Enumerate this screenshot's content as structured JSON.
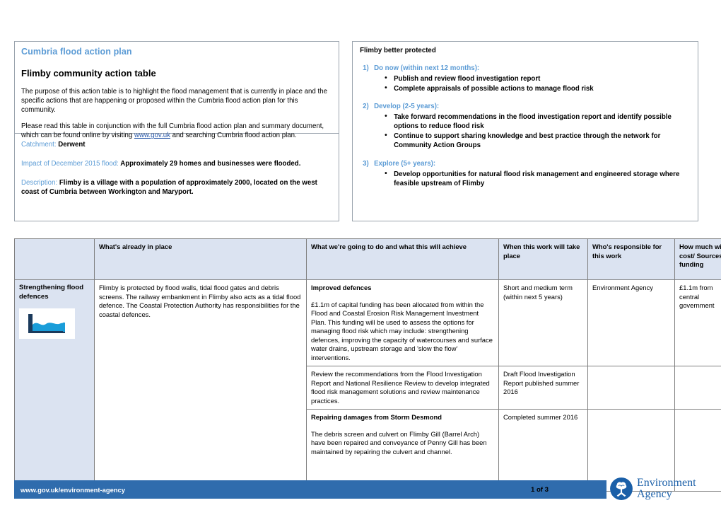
{
  "header": {
    "plan_title": "Cumbria flood action plan",
    "doc_title": "Flimby community action table",
    "purpose_paragraph": "The purpose of this action table is to highlight the flood management that is currently in place and the specific actions that are happening or proposed within the Cumbria flood action plan for this community.",
    "instruction_prefix": "Please read this table in conjunction with the full Cumbria flood action plan and summary document, which can be found online by visiting ",
    "instruction_link": "www.gov.uk",
    "instruction_suffix": " and searching Cumbria flood action plan."
  },
  "details": {
    "catchment_label": "Catchment:",
    "catchment_value": "Derwent",
    "impact_label": "Impact of December 2015 flood:",
    "impact_value": "Approximately 29 homes and businesses were flooded.",
    "description_label": "Description:",
    "description_value": "Flimby is a village with a population of approximately 2000, located on the west coast of Cumbria between Workington and Maryport."
  },
  "better_protected": {
    "title": "Flimby better protected",
    "groups": [
      {
        "number": "1)",
        "heading": "Do now (within next 12 months):",
        "items": [
          "Publish and review flood investigation report",
          "Complete appraisals of possible actions to manage flood risk"
        ]
      },
      {
        "number": "2)",
        "heading": "Develop (2-5 years):",
        "items": [
          "Take forward recommendations in the flood investigation report and identify possible options to reduce flood risk",
          "Continue to support sharing knowledge and best practice through the network for Community Action Groups"
        ]
      },
      {
        "number": "3)",
        "heading": "Explore (5+ years):",
        "items": [
          "Develop opportunities for natural flood risk management and engineered storage where feasible upstream of Flimby"
        ]
      }
    ]
  },
  "table": {
    "headers": {
      "category": "",
      "in_place": "What's already in place",
      "going_to_do": "What we're going to do and what this will achieve",
      "when": "When this work will take place",
      "who": "Who's responsible for this work",
      "cost": "How much will it cost/ Sources of funding"
    },
    "category_label": "Strengthening flood defences",
    "category_icon": "flood-defence-wall-icon",
    "in_place_text": "Flimby is protected by flood walls, tidal flood gates and debris screens.  The railway embankment in Flimby also acts as a tidal flood defence.  The Coastal Protection Authority has responsibilities for the coastal defences.",
    "rows": [
      {
        "subhead": "Improved defences",
        "body": "£1.1m of capital funding has been allocated from within the Flood and Coastal Erosion Risk Management Investment Plan. This funding will be used to assess the options for managing flood risk which may include: strengthening defences, improving the capacity of watercourses and surface water drains, upstream storage and 'slow the flow' interventions.",
        "when": "Short and medium term (within next 5 years)",
        "who": "Environment Agency",
        "cost": "£1.1m from central government"
      },
      {
        "subhead": "",
        "body": "Review the recommendations from the Flood Investigation Report and National Resilience Review to develop integrated flood risk management solutions and review maintenance practices.",
        "when": "Draft Flood Investigation Report published summer 2016",
        "who": "",
        "cost": ""
      },
      {
        "subhead": "Repairing damages from Storm Desmond",
        "body": "The debris screen and culvert on Flimby Gill (Barrel Arch) have been repaired and conveyance of Penny Gill has been maintained by repairing the culvert and channel.",
        "when": "Completed summer 2016",
        "who": "",
        "cost": ""
      }
    ]
  },
  "footer": {
    "url": "www.gov.uk/environment-agency",
    "page": "1 of 3",
    "logo_line1": "Environment",
    "logo_line2": "Agency"
  },
  "colors": {
    "heading_blue": "#5b9bd5",
    "footer_blue": "#2f6cad",
    "table_header_blue": "#dbe3f1",
    "link_blue": "#2354a6",
    "logo_blue": "#1a5fa8"
  }
}
